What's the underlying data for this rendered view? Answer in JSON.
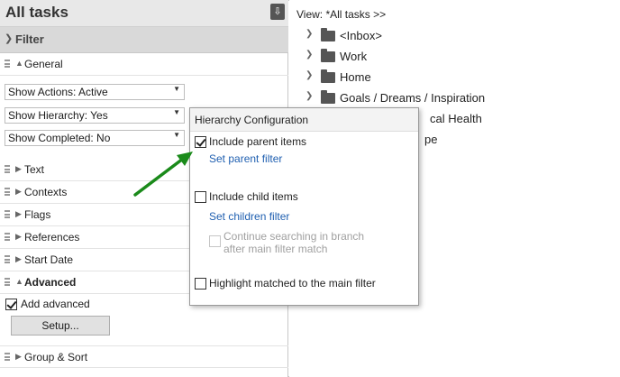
{
  "header": {
    "title": "All tasks",
    "download_icon": "download-icon"
  },
  "filter": {
    "label": "Filter",
    "general_label": "General",
    "selects": [
      {
        "value": "Show Actions: Active"
      },
      {
        "value": "Show Hierarchy: Yes"
      },
      {
        "value": "Show Completed: No"
      }
    ],
    "sections": [
      {
        "label": "Text"
      },
      {
        "label": "Contexts"
      },
      {
        "label": "Flags"
      },
      {
        "label": "References"
      },
      {
        "label": "Start Date"
      }
    ],
    "advanced_label": "Advanced",
    "add_advanced_label": "Add advanced",
    "setup_label": "Setup...",
    "group_sort_label": "Group & Sort"
  },
  "view": {
    "label": "View: *All tasks >>",
    "folders": [
      {
        "label": "<Inbox>"
      },
      {
        "label": "Work"
      },
      {
        "label": "Home"
      },
      {
        "label": "Goals / Dreams / Inspiration"
      },
      {
        "label": "cal Health"
      },
      {
        "label": "pe"
      }
    ]
  },
  "popup": {
    "title": "Hierarchy Configuration",
    "include_parent_label": "Include parent items",
    "set_parent_filter": "Set parent filter",
    "include_child_label": "Include child items",
    "set_children_filter": "Set children filter",
    "continue_searching_line1": "Continue searching in branch",
    "continue_searching_line2": "after main filter match",
    "highlight_label": "Highlight matched to the main filter"
  },
  "colors": {
    "link": "#1f5fb0",
    "arrow": "#1a8a1a",
    "header_bg": "#e8e8e8",
    "filter_bg": "#d9d9d9"
  }
}
